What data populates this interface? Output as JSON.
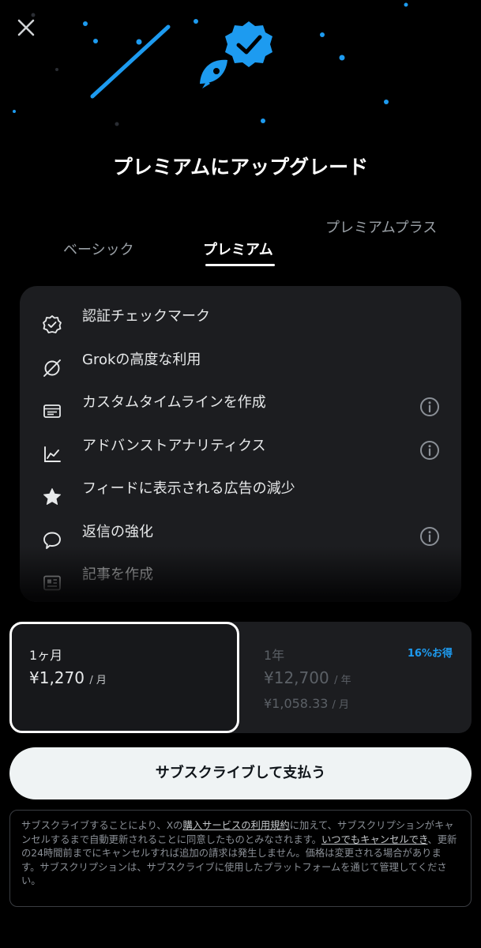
{
  "header": {
    "title": "プレミアムにアップグレード"
  },
  "tabs": [
    {
      "label": "ベーシック",
      "selected": false
    },
    {
      "label": "プレミアム",
      "selected": true
    },
    {
      "label": "プレミアムプラス",
      "selected": false
    }
  ],
  "features": [
    {
      "label": "認証チェックマーク",
      "icon": "verified-check-icon",
      "info": false
    },
    {
      "label": "Grokの高度な利用",
      "icon": "grok-icon",
      "info": false
    },
    {
      "label": "カスタムタイムラインを作成",
      "icon": "timeline-icon",
      "info": true
    },
    {
      "label": "アドバンストアナリティクス",
      "icon": "analytics-icon",
      "info": true
    },
    {
      "label": "フィードに表示される広告の減少",
      "icon": "star-icon",
      "info": false
    },
    {
      "label": "返信の強化",
      "icon": "reply-bubble-icon",
      "info": true
    },
    {
      "label": "記事を作成",
      "icon": "article-icon",
      "info": false
    }
  ],
  "plans": {
    "monthly": {
      "name": "1ヶ月",
      "price": "¥1,270",
      "unit": "/ 月",
      "selected": true
    },
    "yearly": {
      "name": "1年",
      "price": "¥12,700",
      "unit": "/ 年",
      "sub_price": "¥1,058.33",
      "sub_unit": "/ 月",
      "badge": "16%お得",
      "selected": false
    }
  },
  "subscribe_label": "サブスクライブして支払う",
  "legal": {
    "part1": "サブスクライブすることにより、Xの",
    "link1": "購入サービスの利用規約",
    "part2": "に加えて、サブスクリプションがキャンセルするまで自動更新されることに同意したものとみなされます。",
    "link2": "いつでもキャンセルでき",
    "part3": "、更新の24時間前までにキャンセルすれば追加の請求は発生しません。価格は変更される場合があります。サブスクリプションは、サブスクライブに使用したプラットフォームを通じて管理してください。"
  },
  "colors": {
    "accent": "#1d9bf0",
    "background": "#000000",
    "card": "#1c1d20",
    "button": "#eff3f4"
  }
}
